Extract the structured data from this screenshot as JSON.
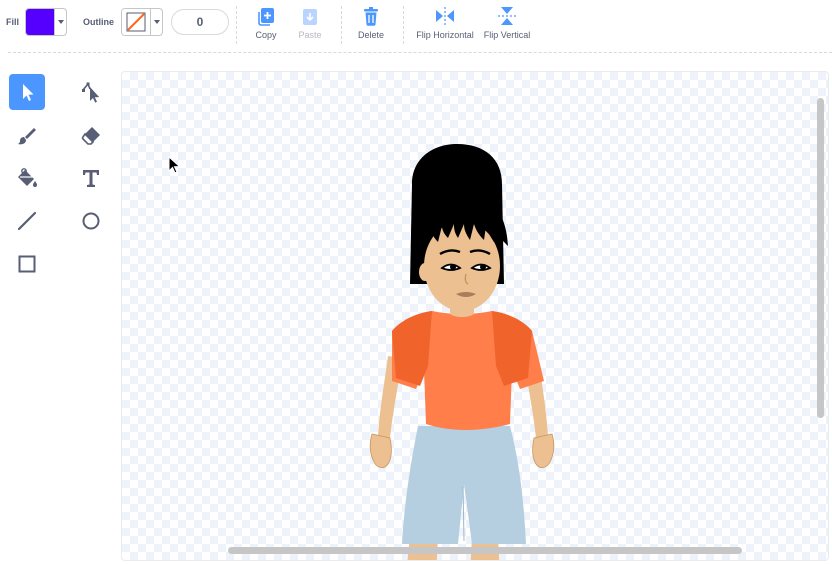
{
  "toolbar": {
    "fill_label": "Fill",
    "fill_color": "#5500ff",
    "outline_label": "Outline",
    "outline_color": "none",
    "outline_width": "0",
    "copy_label": "Copy",
    "paste_label": "Paste",
    "delete_label": "Delete",
    "flip_horizontal_label": "Flip Horizontal",
    "flip_vertical_label": "Flip Vertical",
    "accent": "#4c97ff"
  },
  "tools": [
    {
      "name": "select",
      "icon": "select-arrow-icon",
      "active": true
    },
    {
      "name": "reshape",
      "icon": "reshape-icon",
      "active": false
    },
    {
      "name": "brush",
      "icon": "brush-icon",
      "active": false
    },
    {
      "name": "eraser",
      "icon": "eraser-icon",
      "active": false
    },
    {
      "name": "fill",
      "icon": "paint-bucket-icon",
      "active": false
    },
    {
      "name": "text",
      "icon": "text-icon",
      "active": false
    },
    {
      "name": "line",
      "icon": "line-icon",
      "active": false
    },
    {
      "name": "circle",
      "icon": "circle-icon",
      "active": false
    },
    {
      "name": "rectangle",
      "icon": "rectangle-icon",
      "active": false
    }
  ]
}
